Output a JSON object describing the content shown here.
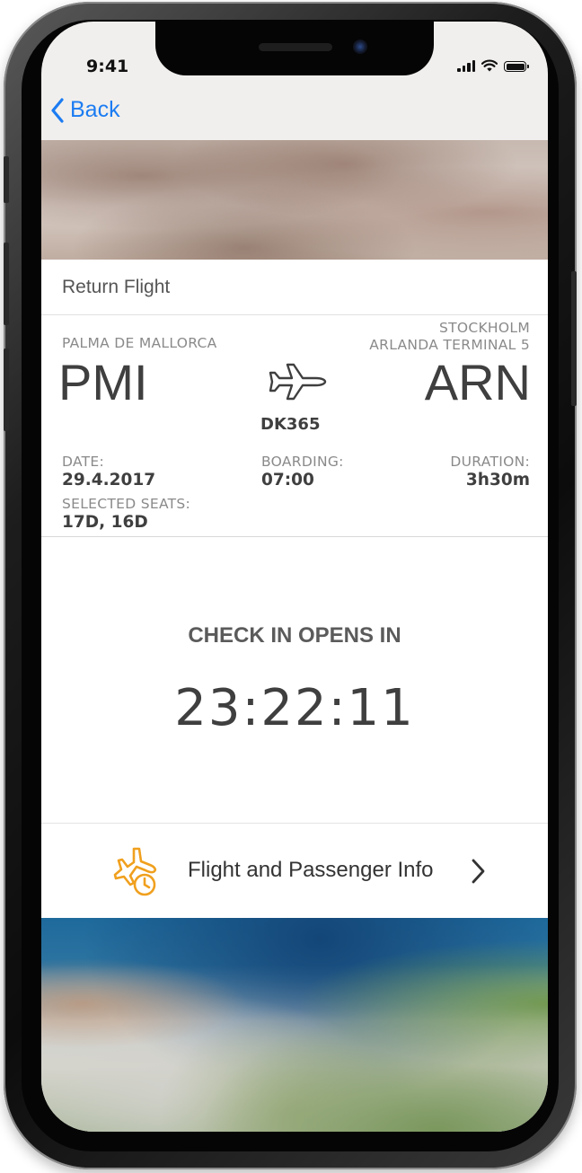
{
  "status_bar": {
    "time": "9:41"
  },
  "nav": {
    "back_label": "Back"
  },
  "card": {
    "title": "Return Flight",
    "origin": {
      "name": "PALMA DE MALLORCA",
      "code": "PMI"
    },
    "destination": {
      "name_line1": "STOCKHOLM",
      "name_line2": "ARLANDA TERMINAL 5",
      "code": "ARN"
    },
    "flight_number": "DK365",
    "date": {
      "label": "DATE:",
      "value": "29.4.2017"
    },
    "boarding": {
      "label": "BOARDING:",
      "value": "07:00"
    },
    "duration": {
      "label": "DURATION:",
      "value": "3h30m"
    },
    "seats": {
      "label": "SELECTED SEATS:",
      "value": "17D, 16D"
    }
  },
  "checkin": {
    "title": "CHECK IN OPENS IN",
    "countdown": "23:22:11"
  },
  "info_row": {
    "label": "Flight and Passenger Info"
  },
  "colors": {
    "accent_blue": "#1c7cf2",
    "accent_orange": "#f0a01e",
    "text_dark": "#3f3f3f"
  },
  "icons": [
    "back-chevron-icon",
    "airplane-icon",
    "flight-clock-icon",
    "chevron-right-icon"
  ]
}
